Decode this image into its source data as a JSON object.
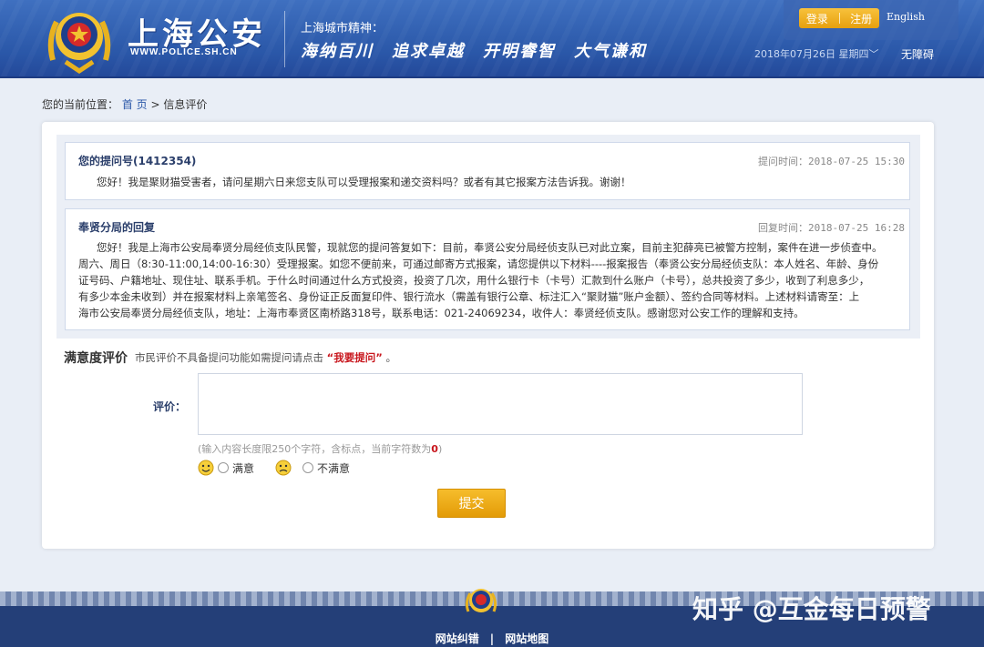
{
  "header": {
    "site_title": "上海公安",
    "site_url": "WWW.POLICE.SH.CN",
    "spirit_label": "上海城市精神：",
    "slogans": [
      "海纳百川",
      "追求卓越",
      "开明睿智",
      "大气谦和"
    ],
    "login": "登录",
    "register": "注册",
    "language": "English",
    "date": "2018年07月26日 星期四",
    "accessibility": "无障碍"
  },
  "breadcrumb": {
    "label": "您的当前位置：",
    "home": "首 页",
    "separator": ">",
    "current": "信息评价"
  },
  "question": {
    "title": "您的提问号(1412354)",
    "time": "提问时间：2018-07-25 15:30",
    "text": "您好！我是聚财猫受害者，请问星期六日来您支队可以受理报案和递交资料吗？或者有其它报案方法告诉我。谢谢！"
  },
  "reply": {
    "title": "奉贤分局的回复",
    "time": "回复时间：2018-07-25 16:28",
    "lines": [
      "您好！我是上海市公安局奉贤分局经侦支队民警，现就您的提问答复如下：目前，奉贤公安分局经侦支队已对此立案，目前主犯薛亮已被警方控制，案件在进一步侦查中。",
      "周六、周日（8:30-11:00,14:00-16:30）受理报案。如您不便前来，可通过邮寄方式报案，请您提供以下材料----报案报告（奉贤公安分局经侦支队：本人姓名、年龄、身份",
      "证号码、户籍地址、现住址、联系手机。于什么时间通过什么方式投资，投资了几次，用什么银行卡（卡号）汇款到什么账户（卡号），总共投资了多少，收到了利息多少，",
      "有多少本金未收到）并在报案材料上亲笔签名、身份证正反面复印件、银行流水（需盖有银行公章、标注汇入“聚财猫”账户金额）、签约合同等材料。上述材料请寄至：上",
      "海市公安局奉贤分局经侦支队，地址：上海市奉贤区南桥路318号，联系电话：021-24069234，收件人：奉贤经侦支队。感谢您对公安工作的理解和支持。"
    ]
  },
  "satisfaction": {
    "title": "满意度评价",
    "note_prefix": "市民评价不具备提问功能如需提问请点击",
    "note_link": "“我要提问”",
    "note_suffix": "。",
    "eval_label": "评价：",
    "eval_value": "",
    "hint_prefix": "(输入内容长度限250个字符，含标点，当前字符数为",
    "hint_count": "0",
    "hint_suffix": ")",
    "option_satisfied": "满意",
    "option_unsatisfied": "不满意",
    "submit": "提交"
  },
  "footer": {
    "link_error": "网站纠错",
    "separator": "|",
    "link_map": "网站地图",
    "watermark": "知乎 @互金每日预警"
  },
  "colors": {
    "header_blue": "#2a57a8",
    "accent_orange": "#e6a00e",
    "link_red": "#c8161d"
  }
}
